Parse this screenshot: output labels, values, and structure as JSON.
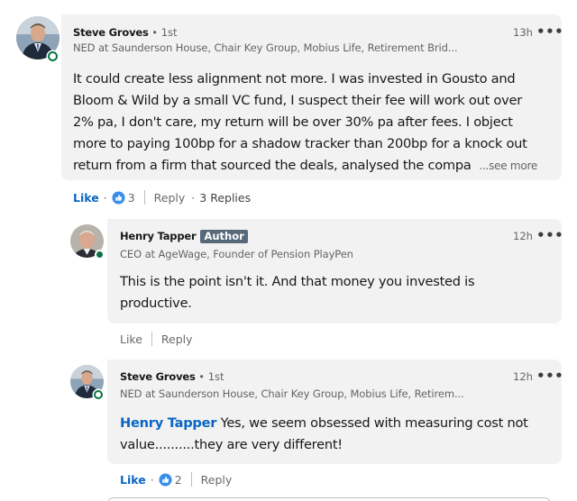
{
  "comments": [
    {
      "author": "Steve Groves",
      "degree": "• 1st",
      "headline": "NED at Saunderson House, Chair Key Group, Mobius Life, Retirement Brid...",
      "time": "13h",
      "text_lines": [
        "It could create less alignment not more. I was invested in Gousto and",
        "Bloom & Wild by a small VC fund, I suspect their fee will work out over",
        "2% pa, I don't care, my return will be over 30% pa after fees. I object",
        "more to paying 100bp for a shadow tracker than 200bp for a knock out",
        "return from a firm that sourced the deals, analysed the compa"
      ],
      "see_more": "...see more",
      "like_label": "Like",
      "reaction_count": "3",
      "reply_label": "Reply",
      "replies_label": "3 Replies"
    },
    {
      "author": "Henry Tapper",
      "badge": "Author",
      "headline": "CEO at AgeWage, Founder of Pension PlayPen",
      "time": "12h",
      "text_lines": [
        "This is the point isn't it. And that money you invested is",
        "productive."
      ],
      "like_label": "Like",
      "reply_label": "Reply"
    },
    {
      "author": "Steve Groves",
      "degree": "• 1st",
      "headline": "NED at Saunderson House, Chair Key Group, Mobius Life, Retirem...",
      "time": "12h",
      "mention": "Henry Tapper",
      "text_line1_rest": " Yes, we seem obsessed with measuring cost not",
      "text_line2": "value..........they are very different!",
      "like_label": "Like",
      "reaction_count": "2",
      "reply_label": "Reply"
    }
  ],
  "more_icon": "ellipsis-icon",
  "reaction_icon": "thumbs-up-icon",
  "colors": {
    "accent": "#0a66c2",
    "bubble": "#f2f2f2",
    "presence": "#057642",
    "badge": "#56687a"
  }
}
